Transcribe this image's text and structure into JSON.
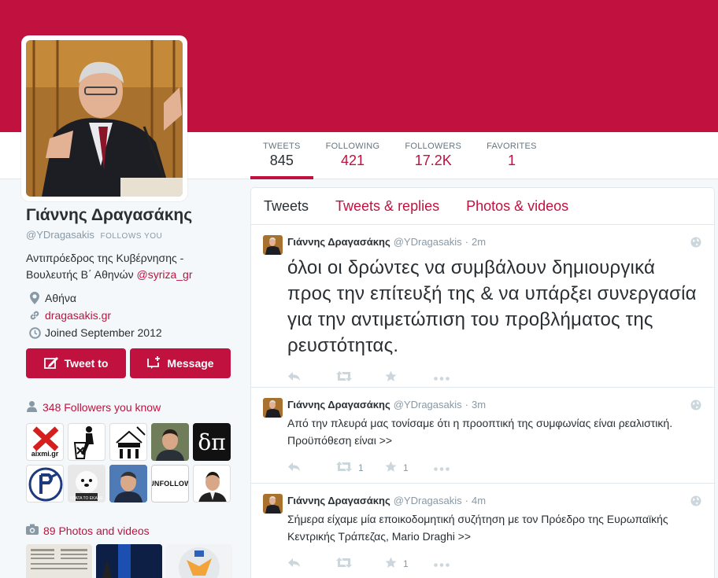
{
  "colors": {
    "brand": "#c0113f",
    "banner": "#c0113f",
    "link": "#c0113f"
  },
  "stats": [
    {
      "label": "TWEETS",
      "value": "845"
    },
    {
      "label": "FOLLOWING",
      "value": "421"
    },
    {
      "label": "FOLLOWERS",
      "value": "17.2K"
    },
    {
      "label": "FAVORITES",
      "value": "1"
    }
  ],
  "profile": {
    "name": "Γιάννης Δραγασάκης",
    "handle": "@YDragasakis",
    "follows_you": "FOLLOWS YOU",
    "bio_text": "Αντιπρόεδρος της Κυβέρνησης - Βουλευτής Β΄ Αθηνών ",
    "bio_link": "@syriza_gr",
    "location": "Αθήνα",
    "website": "dragasakis.gr",
    "joined": "Joined September 2012"
  },
  "buttons": {
    "tweet_to": "Tweet to",
    "message": "Message"
  },
  "followers_you_know": "348 Followers you know",
  "follower_thumbs": [
    "aixmi.gr",
    "",
    "",
    "",
    "δπ",
    "",
    "ΝΤΑΤΑ ΤΟ ΕΚΑΝΕ",
    "",
    "UNFOLLOW",
    ""
  ],
  "photos_videos": "89 Photos and videos",
  "tabs": [
    "Tweets",
    "Tweets & replies",
    "Photos & videos"
  ],
  "tweets": [
    {
      "name": "Γιάννης Δραγασάκης",
      "handle": "@YDragasakis",
      "time": "2m",
      "text": "όλοι οι δρώντες να συμβάλουν δημιουργικά προς την επίτευξή της & να υπάρξει συνεργασία για την αντιμετώπιση του προβλήματος της ρευστότητας.",
      "retweets": "",
      "favorites": ""
    },
    {
      "name": "Γιάννης Δραγασάκης",
      "handle": "@YDragasakis",
      "time": "3m",
      "text": "Από την πλευρά μας τονίσαμε ότι η προοπτική της συμφωνίας είναι ρεαλιστική. Προϋπόθεση είναι  >>",
      "retweets": "1",
      "favorites": "1"
    },
    {
      "name": "Γιάννης Δραγασάκης",
      "handle": "@YDragasakis",
      "time": "4m",
      "text": "Σήμερα είχαμε μία εποικοδομητική συζήτηση με τον Πρόεδρο της Ευρωπαϊκής Κεντρικής Τράπεζας, Mario Draghi >>",
      "retweets": "",
      "favorites": "1"
    }
  ]
}
